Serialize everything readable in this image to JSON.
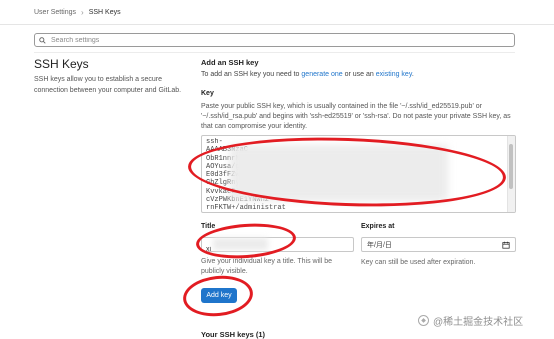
{
  "breadcrumb": {
    "parent": "User Settings",
    "current": "SSH Keys"
  },
  "search": {
    "placeholder": "Search settings",
    "icon": "search-icon"
  },
  "left": {
    "title": "SSH Keys",
    "description": "SSH keys allow you to establish a secure connection between your computer and GitLab."
  },
  "add_section": {
    "heading": "Add an SSH key",
    "intro_prefix": "To add an SSH key you need to ",
    "generate_link": "generate one",
    "intro_middle": " or use an ",
    "existing_link": "existing key",
    "intro_suffix": "."
  },
  "key_field": {
    "label": "Key",
    "help": "Paste your public SSH key, which is usually contained in the file '~/.ssh/id_ed25519.pub' or '~/.ssh/id_rsa.pub' and begins with 'ssh-ed25519' or 'ssh-rsa'. Do not paste your private SSH key, as that can compromise your identity.",
    "value": "ssh-\nAAAAB3NzaC                                                                  4grfNIeMy5Rd43\nObR1nnrNKA                                                                  IY4rLBtpfb0W\nAOYusa/gPl                                                                  mRhz9NCg/U9\nE0d3fFZwUR                                                                  s53MiDnLhQ\nGhZlgRnyWL                                                                  jCXzhtZisq4LhoK\nKvvkaeCJnXY                                                                 vtePurleglbaTDE\ncVzPWKbnE1YNwhz                                                             rKssDaVa+MOmJxzz3uekjFATIC\nrnFKTW+/administrat"
  },
  "title_field": {
    "label": "Title",
    "value": "xi",
    "help": "Give your individual key a title. This will be publicly visible."
  },
  "expires_field": {
    "label": "Expires at",
    "value": "年/月/日",
    "help": "Key can still be used after expiration.",
    "icon": "calendar-icon"
  },
  "add_button": {
    "label": "Add key"
  },
  "your_keys": {
    "heading": "Your SSH keys (1)"
  },
  "watermark": {
    "text": "@稀土掘金技术社区"
  },
  "colors": {
    "accent": "#1f75cb",
    "annotation": "#e21c22"
  }
}
